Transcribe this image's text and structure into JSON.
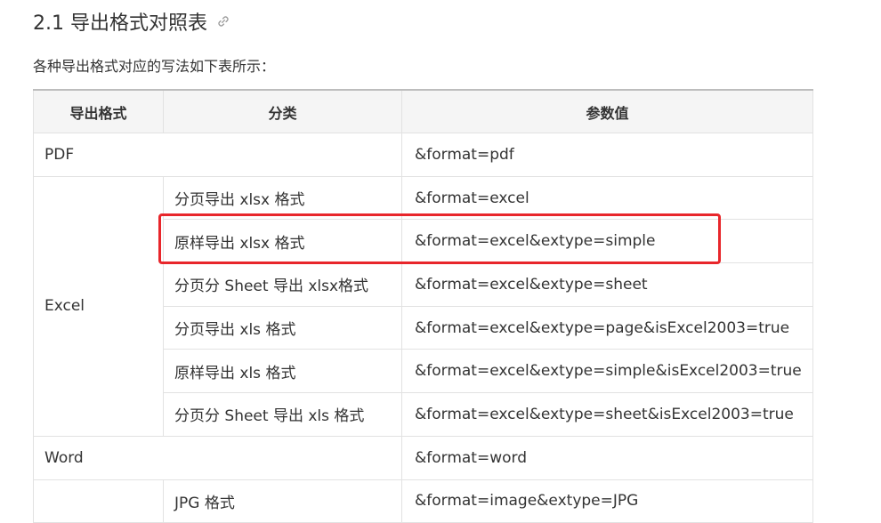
{
  "section": {
    "title": "2.1 导出格式对照表",
    "intro": "各种导出格式对应的写法如下表所示："
  },
  "table": {
    "headers": [
      "导出格式",
      "分类",
      "参数值"
    ],
    "rows": [
      {
        "format": "PDF",
        "category": "",
        "param": "&format=pdf"
      },
      {
        "format": "Excel",
        "category": "分页导出 xlsx 格式",
        "param": "&format=excel"
      },
      {
        "format": "",
        "category": "原样导出 xlsx 格式",
        "param": "&format=excel&extype=simple"
      },
      {
        "format": "",
        "category": "分页分 Sheet 导出 xlsx格式",
        "param": "&format=excel&extype=sheet"
      },
      {
        "format": "",
        "category": "分页导出 xls 格式",
        "param": "&format=excel&extype=page&isExcel2003=true"
      },
      {
        "format": "",
        "category": "原样导出 xls 格式",
        "param": "&format=excel&extype=simple&isExcel2003=true"
      },
      {
        "format": "",
        "category": "分页分 Sheet 导出 xls 格式",
        "param": "&format=excel&extype=sheet&isExcel2003=true"
      },
      {
        "format": "Word",
        "category": "",
        "param": "&format=word"
      },
      {
        "format": "",
        "category": "JPG 格式",
        "param": "&format=image&extype=JPG"
      }
    ]
  },
  "highlight": {
    "color": "#e8262b",
    "row_index": 2
  },
  "colors": {
    "text": "#333333",
    "header_bg": "#f5f5f5",
    "border": "#e2e2e2"
  }
}
